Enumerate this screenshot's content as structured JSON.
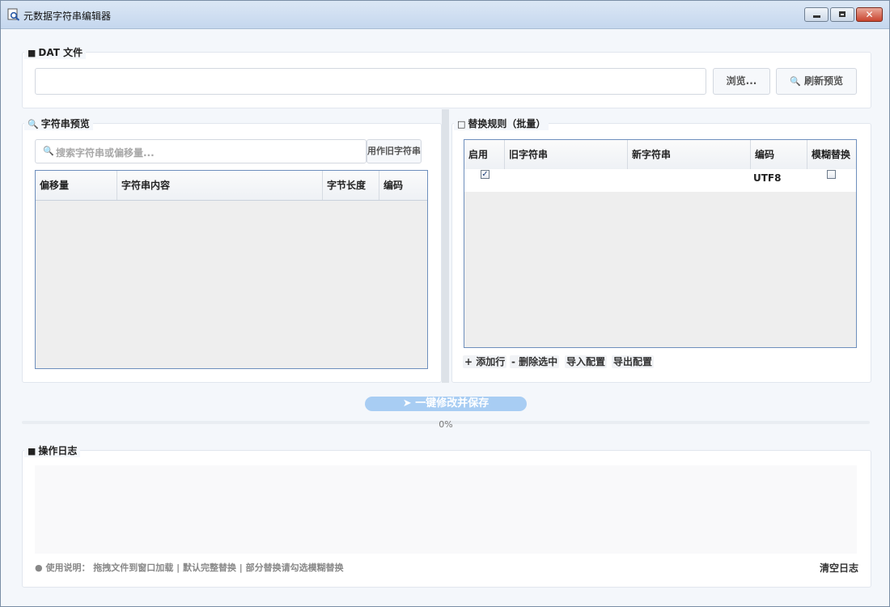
{
  "window": {
    "title": "元数据字符串编辑器",
    "controls": {
      "minimize": "minimize-icon",
      "maximize": "maximize-icon",
      "close": "✕"
    }
  },
  "dat_file": {
    "title": "DAT 文件",
    "title_icon": "folder-icon",
    "path_value": "",
    "browse_label": "浏览...",
    "refresh_label": "刷新预览",
    "refresh_icon": "search-icon"
  },
  "preview": {
    "title": "字符串预览",
    "title_icon": "search-icon",
    "search_placeholder": "搜索字符串或偏移量...",
    "use_as_old_label": "用作旧字符串",
    "columns": [
      "偏移量",
      "字符串内容",
      "字节长度",
      "编码"
    ],
    "rows": []
  },
  "rules": {
    "title": "替换规则（批量）",
    "columns": [
      "启用",
      "旧字符串",
      "新字符串",
      "编码",
      "模糊替换"
    ],
    "rows": [
      {
        "enabled": true,
        "old": "",
        "new": "",
        "encoding": "UTF8",
        "fuzzy": false
      }
    ],
    "add_row_label": "+ 添加行",
    "delete_label": "- 删除选中",
    "import_label": "导入配置",
    "export_label": "导出配置"
  },
  "action": {
    "run_label": "一键修改并保存",
    "run_icon": "rocket-icon",
    "progress_percent": 0,
    "progress_text": "0%"
  },
  "log": {
    "title": "操作日志",
    "title_icon": "open-folder-icon",
    "content": "",
    "hint": "使用说明： 拖拽文件到窗口加载 | 默认完整替换 | 部分替换请勾选模糊替换",
    "hint_icon": "bulb-icon",
    "clear_label": "清空日志"
  },
  "colors": {
    "accent": "#3f86d9",
    "run_button": "#a8cdf3",
    "table_border": "#6e8fbd"
  }
}
